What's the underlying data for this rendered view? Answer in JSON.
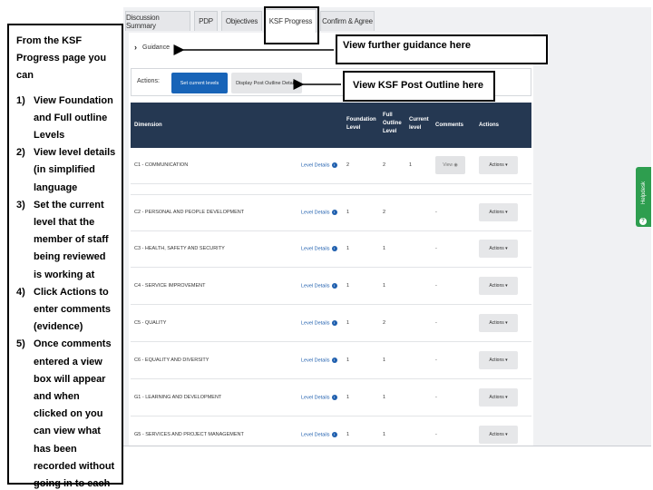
{
  "tabs": [
    {
      "label": "Discussion Summary"
    },
    {
      "label": "PDP"
    },
    {
      "label": "Objectives"
    },
    {
      "label": "KSF Progress"
    },
    {
      "label": "Confirm & Agree"
    }
  ],
  "guidance": {
    "label": "Guidance"
  },
  "actions_bar": {
    "label": "Actions:",
    "set_levels_label": "Set current levels",
    "display_outline_label": "Display Post Outline Details"
  },
  "table": {
    "headers": {
      "dimension": "Dimension",
      "foundation": "Foundation Level",
      "full_outline": "Full Outline Level",
      "current": "Current level",
      "comments": "Comments",
      "actions": "Actions"
    },
    "rows": [
      {
        "dimension": "C1 - COMMUNICATION",
        "level_details": "Level Details",
        "foundation": "2",
        "full": "2",
        "current": "1",
        "comments": "View",
        "actions": "Actions ▾"
      },
      {
        "dimension": "C2 - PERSONAL AND PEOPLE DEVELOPMENT",
        "level_details": "Level Details",
        "foundation": "1",
        "full": "2",
        "current": "",
        "comments": "-",
        "actions": "Actions ▾"
      },
      {
        "dimension": "C3 - HEALTH, SAFETY AND SECURITY",
        "level_details": "Level Details",
        "foundation": "1",
        "full": "1",
        "current": "",
        "comments": "-",
        "actions": "Actions ▾"
      },
      {
        "dimension": "C4 - SERVICE IMPROVEMENT",
        "level_details": "Level Details",
        "foundation": "1",
        "full": "1",
        "current": "",
        "comments": "-",
        "actions": "Actions ▾"
      },
      {
        "dimension": "C5 - QUALITY",
        "level_details": "Level Details",
        "foundation": "1",
        "full": "2",
        "current": "",
        "comments": "-",
        "actions": "Actions ▾"
      },
      {
        "dimension": "C6 - EQUALITY AND DIVERSITY",
        "level_details": "Level Details",
        "foundation": "1",
        "full": "1",
        "current": "",
        "comments": "-",
        "actions": "Actions ▾"
      },
      {
        "dimension": "G1 - LEARNING AND DEVELOPMENT",
        "level_details": "Level Details",
        "foundation": "1",
        "full": "1",
        "current": "",
        "comments": "-",
        "actions": "Actions ▾"
      },
      {
        "dimension": "G5 - SERVICES AND PROJECT MANAGEMENT",
        "level_details": "Level Details",
        "foundation": "1",
        "full": "1",
        "current": "",
        "comments": "-",
        "actions": "Actions ▾"
      }
    ]
  },
  "helpdesk": {
    "label": "Helpdesk",
    "icon": "question-icon"
  },
  "sidenote": {
    "intro": "From the KSF Progress page you can",
    "steps": [
      {
        "num": "1)",
        "text": "View Foundation and Full outline Levels"
      },
      {
        "num": "2)",
        "text": "View level details (in simplified language"
      },
      {
        "num": "3)",
        "text": "Set the current level that the member of staff being reviewed is working at"
      },
      {
        "num": "4)",
        "text": "Click Actions to enter comments (evidence)"
      },
      {
        "num": "5)",
        "text": "Once comments entered a view box will appear and when clicked on you can view what has been recorded without going in to each dimension"
      }
    ]
  },
  "callouts": {
    "guidance": "View further guidance here",
    "outline": "View KSF Post Outline here"
  },
  "colors": {
    "primary_button": "#1864b8",
    "table_header": "#253852",
    "helpdesk": "#2e9e4f",
    "link": "#1f5fae"
  }
}
